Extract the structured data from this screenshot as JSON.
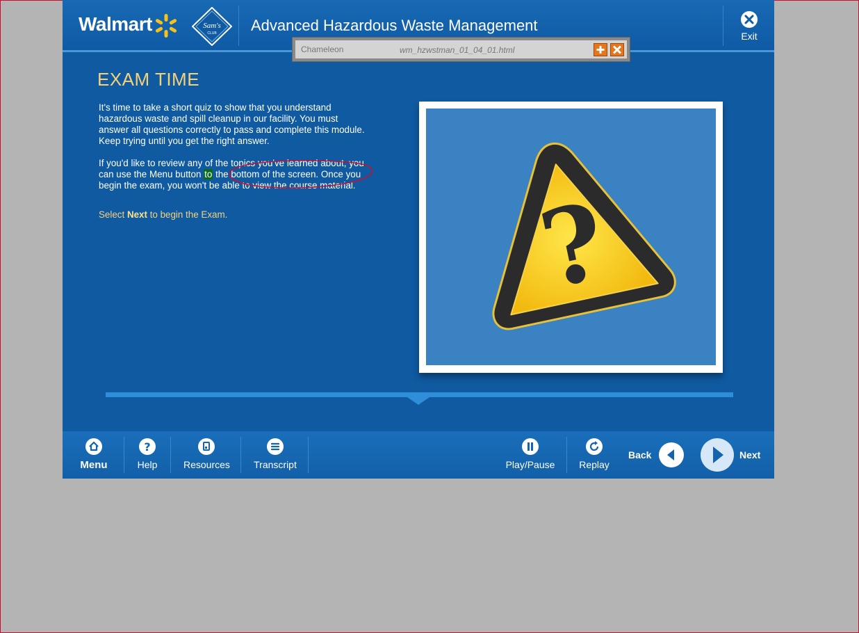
{
  "header": {
    "brand": "Walmart",
    "sams_logo_text": "Sam's CLUB",
    "course_title": "Advanced Hazardous Waste Management",
    "exit_label": "Exit"
  },
  "chameleon": {
    "logo": "Chameleon",
    "filename": "wm_hzwstman_01_04_01.html"
  },
  "content": {
    "heading": "EXAM TIME",
    "paragraph1": "It's time to take a short quiz to show that you understand hazardous waste and spill cleanup in our facility. You must answer all questions correctly to pass and complete this module. Keep trying until you get the right answer.",
    "paragraph2_a": "If you'd like to review any of the topics you've learned about, you can use the Menu button ",
    "paragraph2_highlight": "to",
    "paragraph2_b": " the bottom of the screen. Once you begin the exam, you won't be able to view the course material.",
    "select_prefix": "Select ",
    "select_bold": "Next",
    "select_suffix": " to begin the Exam."
  },
  "footer": {
    "menu": "Menu",
    "help": "Help",
    "resources": "Resources",
    "transcript": "Transcript",
    "play_pause": "Play/Pause",
    "replay": "Replay",
    "back": "Back",
    "next": "Next"
  },
  "colors": {
    "primary_blue": "#0f5aa0",
    "heading_gold": "#f5d27a",
    "highlight_green": "#0a6b1c",
    "annotation_red": "#c8102e"
  }
}
